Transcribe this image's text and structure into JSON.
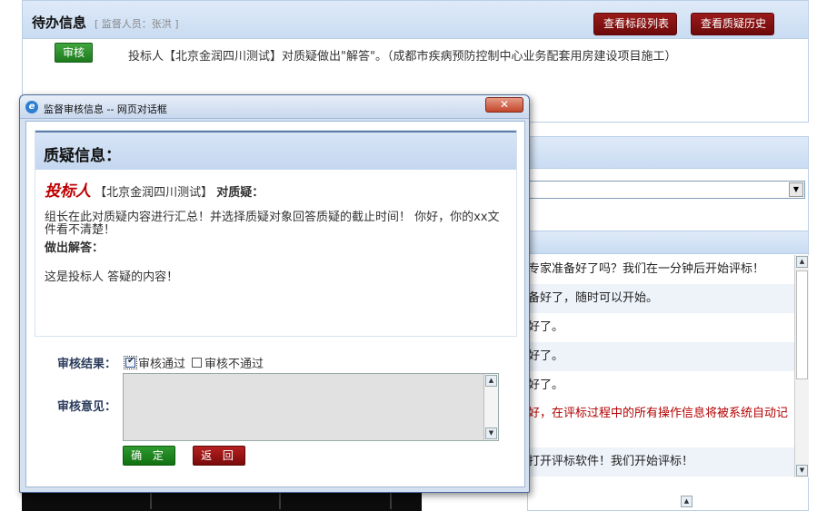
{
  "page": {
    "title": "待办信息",
    "supervisor": "[ 监督人员：张洪 ]",
    "buttons": {
      "bid_list": "查看标段列表",
      "query_history": "查看质疑历史",
      "audit": "审核"
    },
    "message": "投标人【北京金润四川测试】对质疑做出\"解答\"。（成都市疾病预防控制中心业务配套用房建设项目施工）",
    "chat_lines": [
      "专家准备好了吗？我们在一分钟后开始评标！",
      "备好了，随时可以开始。",
      "好了。",
      "好了。",
      "好了。",
      "好，在评标过程中的所有操作信息将被系统自动记",
      "打开评标软件！我们开始评标！"
    ]
  },
  "dialog": {
    "window_title": "监督审核信息 -- 网页对话框",
    "close_label": "✕",
    "info_title": "质疑信息：",
    "bidder_tag": "投标人",
    "bidder_name": "【北京金润四川测试】",
    "bidder_suffix": "对质疑：",
    "query_text": "组长在此对质疑内容进行汇总！并选择质疑对象回答质疑的截止时间！ 你好，你的xx文件看不清楚！",
    "answer_label": "做出解答：",
    "answer_text": "这是投标人 答疑的内容！",
    "result_label": "审核结果：",
    "option_pass": "审核通过",
    "option_fail": "审核不通过",
    "opinion_label": "审核意见：",
    "confirm_label": "确 定",
    "back_label": "返 回"
  },
  "colors": {
    "header_blue": "#c9dcf2",
    "dark_red": "#7a0a0a",
    "green": "#1e7a1e",
    "bidder_red": "#c00000"
  },
  "icons": {
    "dialog_icon": "ie-icon",
    "close": "close-icon",
    "checkbox_checked": "check-icon"
  }
}
